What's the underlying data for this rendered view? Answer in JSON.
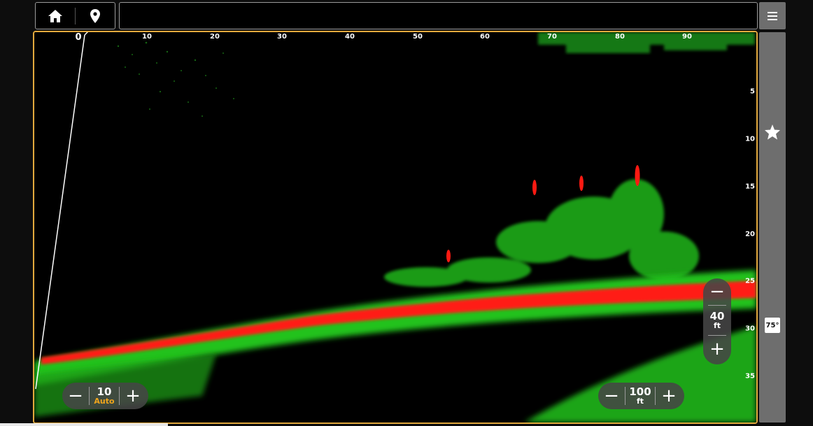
{
  "toolbar": {
    "home_icon": "home-icon",
    "waypoint_icon": "map-pin-icon",
    "title": "",
    "menu_icon": "hamburger-menu-icon"
  },
  "side_panel": {
    "favorite_icon": "star-icon",
    "temperature": "75°"
  },
  "sonar": {
    "range_ticks": [
      "0",
      "10",
      "20",
      "30",
      "40",
      "50",
      "60",
      "70",
      "80",
      "90"
    ],
    "depth_ticks": [
      "5",
      "10",
      "15",
      "20",
      "25",
      "30",
      "35"
    ],
    "colors": {
      "weak_return": "#21c21e",
      "strong_return": "#ff1a12",
      "frame": "#e2a93d",
      "background": "#000000"
    }
  },
  "controls": {
    "gain": {
      "value": "10",
      "mode": "Auto",
      "minus": "−",
      "plus": "+"
    },
    "range": {
      "value": "100",
      "unit": "ft",
      "minus": "−",
      "plus": "+"
    },
    "depth": {
      "value": "40",
      "unit": "ft",
      "minus": "−",
      "plus": "+"
    }
  }
}
